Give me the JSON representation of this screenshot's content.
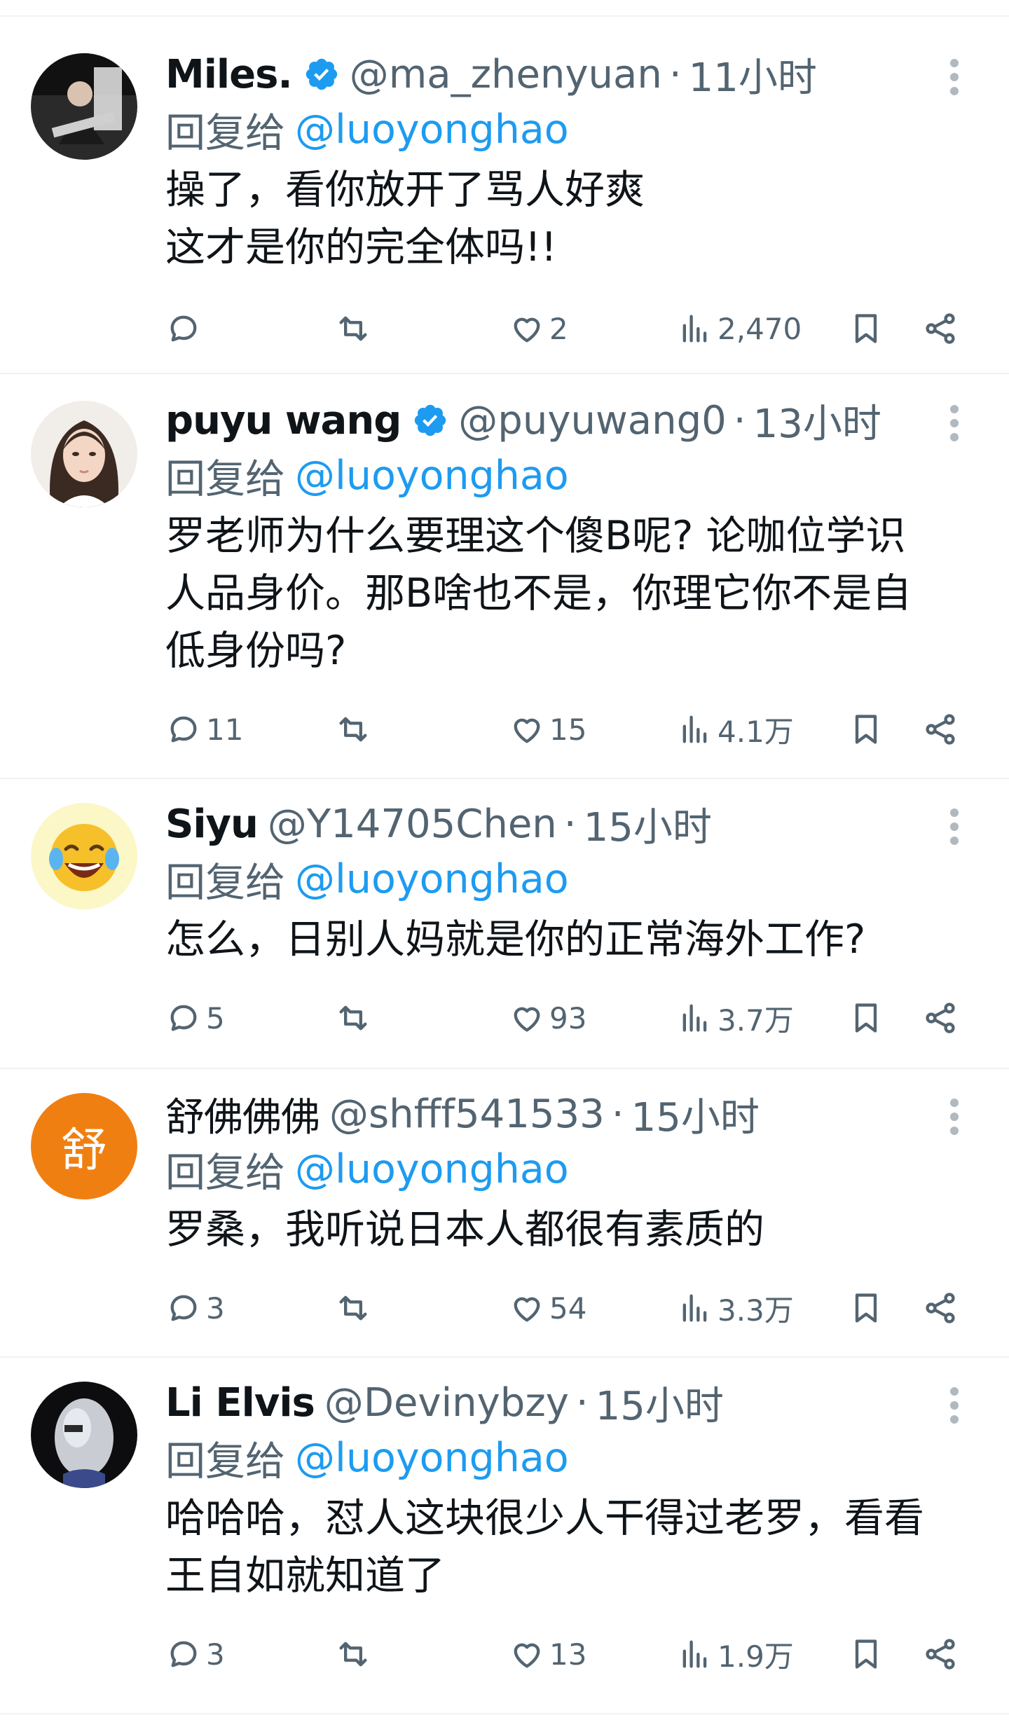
{
  "replies": [
    {
      "name": "Miles.",
      "verified": true,
      "handle": "@ma_zhenyuan",
      "time": "11小时",
      "reply_to_prefix": "回复给",
      "reply_to_handle": "@luoyonghao",
      "text": "操了，看你放开了骂人好爽\n这才是你的完全体吗!!",
      "replies_count": "",
      "likes": "2",
      "views": "2,470"
    },
    {
      "name": "puyu wang",
      "verified": true,
      "handle": "@puyuwang0",
      "time": "13小时",
      "reply_to_prefix": "回复给",
      "reply_to_handle": "@luoyonghao",
      "text": "罗老师为什么要理这个傻B呢? 论咖位学识\n人品身价。那B啥也不是，你理它你不是自\n低身份吗?",
      "replies_count": "11",
      "likes": "15",
      "views": "4.1万"
    },
    {
      "name": "Siyu",
      "verified": false,
      "handle": "@Y14705Chen",
      "time": "15小时",
      "reply_to_prefix": "回复给",
      "reply_to_handle": "@luoyonghao",
      "text": "怎么，日别人妈就是你的正常海外工作?",
      "replies_count": "5",
      "likes": "93",
      "views": "3.7万"
    },
    {
      "name": "舒佛佛佛",
      "verified": false,
      "handle": "@shfff541533",
      "time": "15小时",
      "reply_to_prefix": "回复给",
      "reply_to_handle": "@luoyonghao",
      "text": "罗桑，我听说日本人都很有素质的",
      "replies_count": "3",
      "likes": "54",
      "views": "3.3万",
      "avatar_letter": "舒"
    },
    {
      "name": "Li Elvis",
      "verified": false,
      "handle": "@Devinybzy",
      "time": "15小时",
      "reply_to_prefix": "回复给",
      "reply_to_handle": "@luoyonghao",
      "text": "哈哈哈，怼人这块很少人干得过老罗，看看\n王自如就知道了",
      "replies_count": "3",
      "likes": "13",
      "views": "1.9万"
    }
  ],
  "colors": {
    "accent": "#1d9bf0",
    "secondary_text": "#536471",
    "divider": "#eff3f4",
    "orange_avatar": "#f07f12"
  },
  "icons": [
    "reply-icon",
    "retweet-icon",
    "like-icon",
    "views-icon",
    "bookmark-icon",
    "share-icon",
    "more-icon",
    "verified-icon"
  ]
}
